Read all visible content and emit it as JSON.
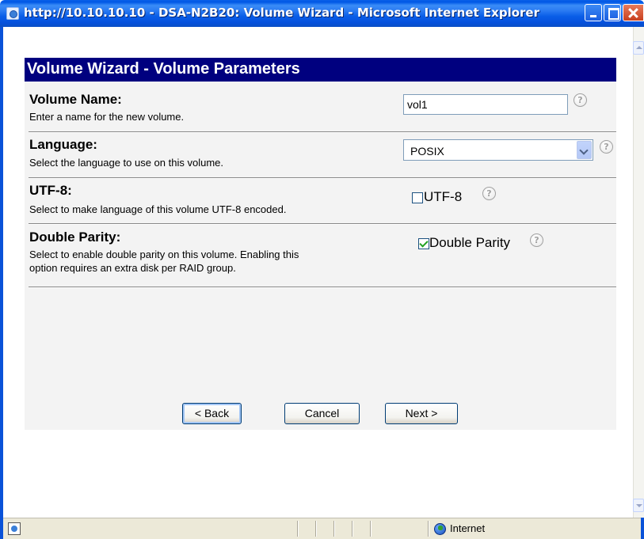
{
  "window": {
    "title": "http://10.10.10.10 - DSA-N2B20: Volume Wizard - Microsoft Internet Explorer"
  },
  "wizard": {
    "header": "Volume Wizard - Volume Parameters",
    "rows": [
      {
        "title": "Volume Name:",
        "description": "Enter a name for the new volume.",
        "input_value": "vol1"
      },
      {
        "title": "Language:",
        "description": "Select the language to use on this volume.",
        "selected_option": "POSIX"
      },
      {
        "title": "UTF-8:",
        "description": "Select to make language of this volume UTF-8 encoded.",
        "checkbox_label": "UTF-8",
        "checked": false
      },
      {
        "title": "Double Parity:",
        "description_line1": "Select to enable double parity on this volume. Enabling this",
        "description_line2": "option requires an extra disk per RAID group.",
        "checkbox_label": "Double Parity",
        "checked": true
      }
    ],
    "buttons": {
      "back": "< Back",
      "cancel": "Cancel",
      "next": "Next >"
    },
    "help_glyph": "?"
  },
  "statusbar": {
    "zone": "Internet"
  },
  "colors": {
    "header_bg": "#00007f",
    "panel_bg": "#f3f3f3",
    "titlebar": "#0a5ee8"
  },
  "icons": [
    "ie-page-icon",
    "minimize-icon",
    "maximize-icon",
    "close-icon",
    "help-icon",
    "chevron-down-icon",
    "globe-icon"
  ]
}
